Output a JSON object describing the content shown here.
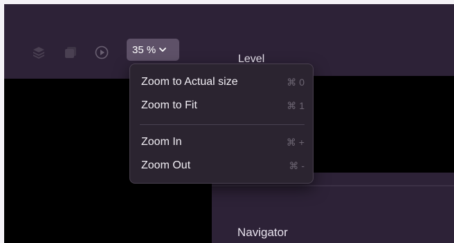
{
  "toolbar": {
    "icons": [
      "layers-icon",
      "square-icon",
      "play-circle-icon"
    ],
    "zoom_value": "35 %"
  },
  "canvas": {
    "level_label": "Level",
    "navigator_label": "Navigator"
  },
  "zoom_menu": {
    "items": [
      {
        "label": "Zoom to Actual size",
        "shortcut": "⌘ 0"
      },
      {
        "label": "Zoom to Fit",
        "shortcut": "⌘ 1"
      },
      {
        "label": "Zoom In",
        "shortcut": "⌘ +"
      },
      {
        "label": "Zoom Out",
        "shortcut": "⌘ -"
      }
    ]
  },
  "colors": {
    "toolbar_bg": "#2d2237",
    "menu_bg": "#2b2430",
    "zoom_button_bg": "#5e5168",
    "canvas_bg": "#000000"
  }
}
